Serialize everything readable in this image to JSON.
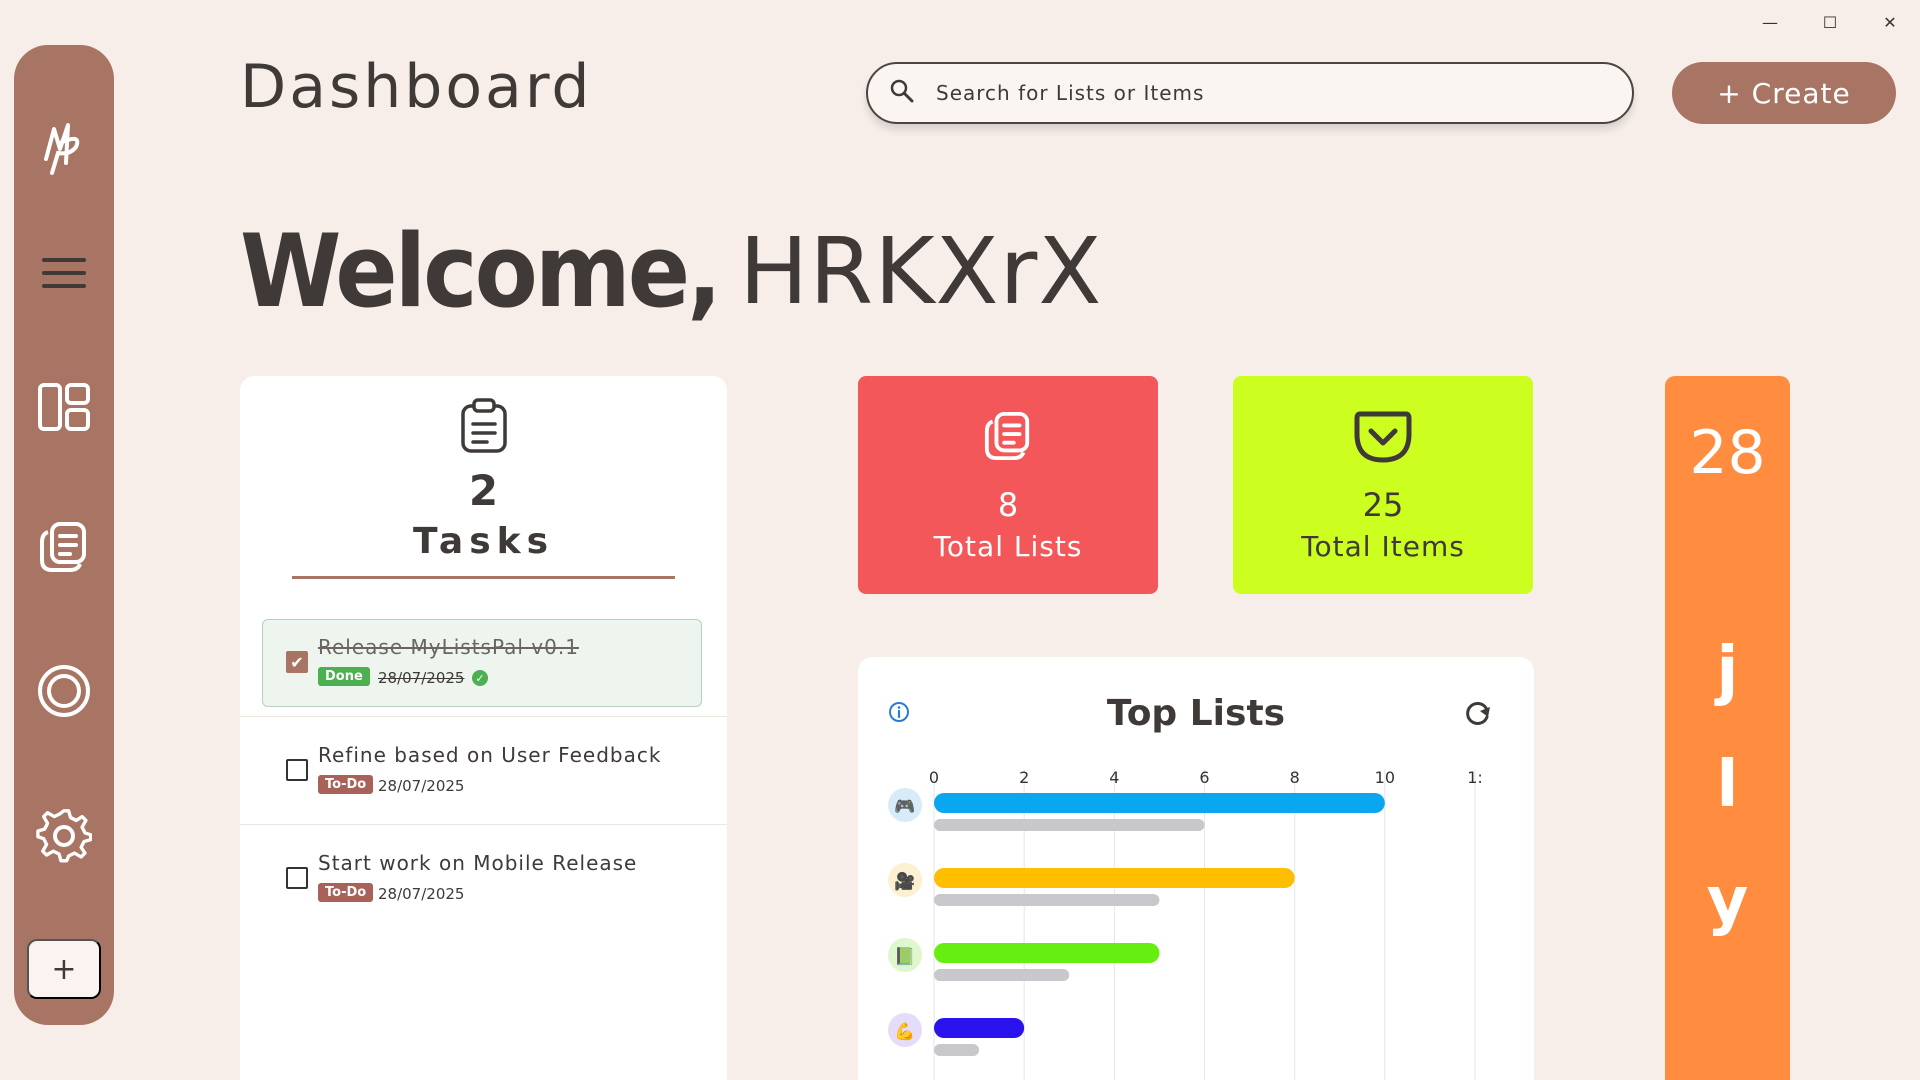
{
  "window": {
    "minimize": "—",
    "maximize": "☐",
    "close": "✕"
  },
  "sidebar": {
    "items": [
      {
        "name": "logo",
        "label": "MP"
      },
      {
        "name": "menu"
      },
      {
        "name": "dashboard"
      },
      {
        "name": "lists"
      },
      {
        "name": "progress"
      },
      {
        "name": "settings"
      }
    ],
    "add_label": "+"
  },
  "header": {
    "title": "Dashboard",
    "search_placeholder": "Search for Lists or Items",
    "create_label": "+ Create"
  },
  "welcome": {
    "greeting": "Welcome,",
    "username": "HRKXrX"
  },
  "tasks": {
    "count": "2",
    "label": "Tasks",
    "items": [
      {
        "title": "Release MyListsPal v0.1",
        "status": "Done",
        "date": "28/07/2025",
        "done": true
      },
      {
        "title": "Refine based on User Feedback",
        "status": "To-Do",
        "date": "28/07/2025",
        "done": false
      },
      {
        "title": "Start work on Mobile Release",
        "status": "To-Do",
        "date": "28/07/2025",
        "done": false
      }
    ]
  },
  "stats": {
    "lists": {
      "value": "8",
      "label": "Total Lists",
      "color": "#f3575a"
    },
    "items": {
      "value": "25",
      "label": "Total Items",
      "color": "#ccff1f"
    }
  },
  "top_lists": {
    "title": "Top Lists",
    "chart_data": {
      "type": "bar",
      "orientation": "horizontal",
      "title": "Top Lists",
      "x_ticks": [
        "0",
        "2",
        "4",
        "6",
        "8",
        "10",
        "1:"
      ],
      "xlim": [
        0,
        12
      ],
      "categories": [
        "gamepad",
        "camera",
        "book",
        "hand"
      ],
      "series": [
        {
          "values": [
            10,
            8,
            5,
            2
          ],
          "colors": [
            "#0aa6f0",
            "#ffbf00",
            "#66ee11",
            "#2a12ee"
          ]
        },
        {
          "values": [
            6,
            5,
            3,
            1
          ],
          "color": "#c8c8cc"
        }
      ],
      "category_icons": [
        "🎮",
        "🎥",
        "📗",
        "💪"
      ],
      "icon_backgrounds": [
        "#d7ecf8",
        "#fbf0cf",
        "#def7cf",
        "#e4dcf9"
      ],
      "grid": true
    }
  },
  "date_card": {
    "day": "28",
    "letters": [
      "j",
      "l",
      "y"
    ],
    "color": "#ff8c3f"
  }
}
